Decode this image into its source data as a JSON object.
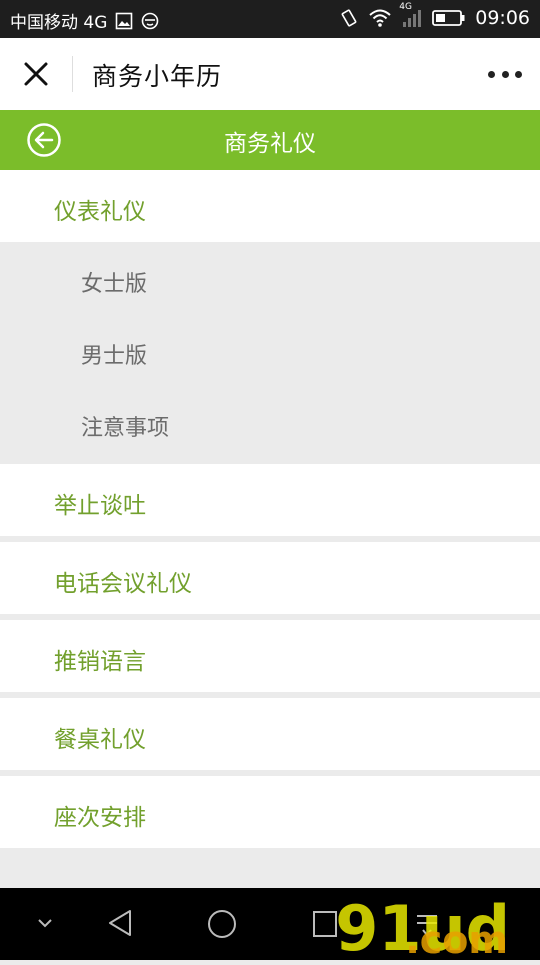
{
  "status_bar": {
    "carrier": "中国移动 4G",
    "network": "4G",
    "time": "09:06"
  },
  "title_bar": {
    "title": "商务小年历"
  },
  "section": {
    "title": "商务礼仪"
  },
  "menu": {
    "item_0": "仪表礼仪",
    "sub_0": "女士版",
    "sub_1": "男士版",
    "sub_2": "注意事项",
    "item_1": "举止谈吐",
    "item_2": "电话会议礼仪",
    "item_3": "推销语言",
    "item_4": "餐桌礼仪",
    "item_5": "座次安排"
  },
  "watermark": {
    "main": "91ud",
    "suffix": ".com"
  },
  "colors": {
    "accent": "#7bbd2a",
    "green_text": "#72a02d",
    "statusbar": "#1e1e1e",
    "submenu_bg": "#ebebeb"
  }
}
